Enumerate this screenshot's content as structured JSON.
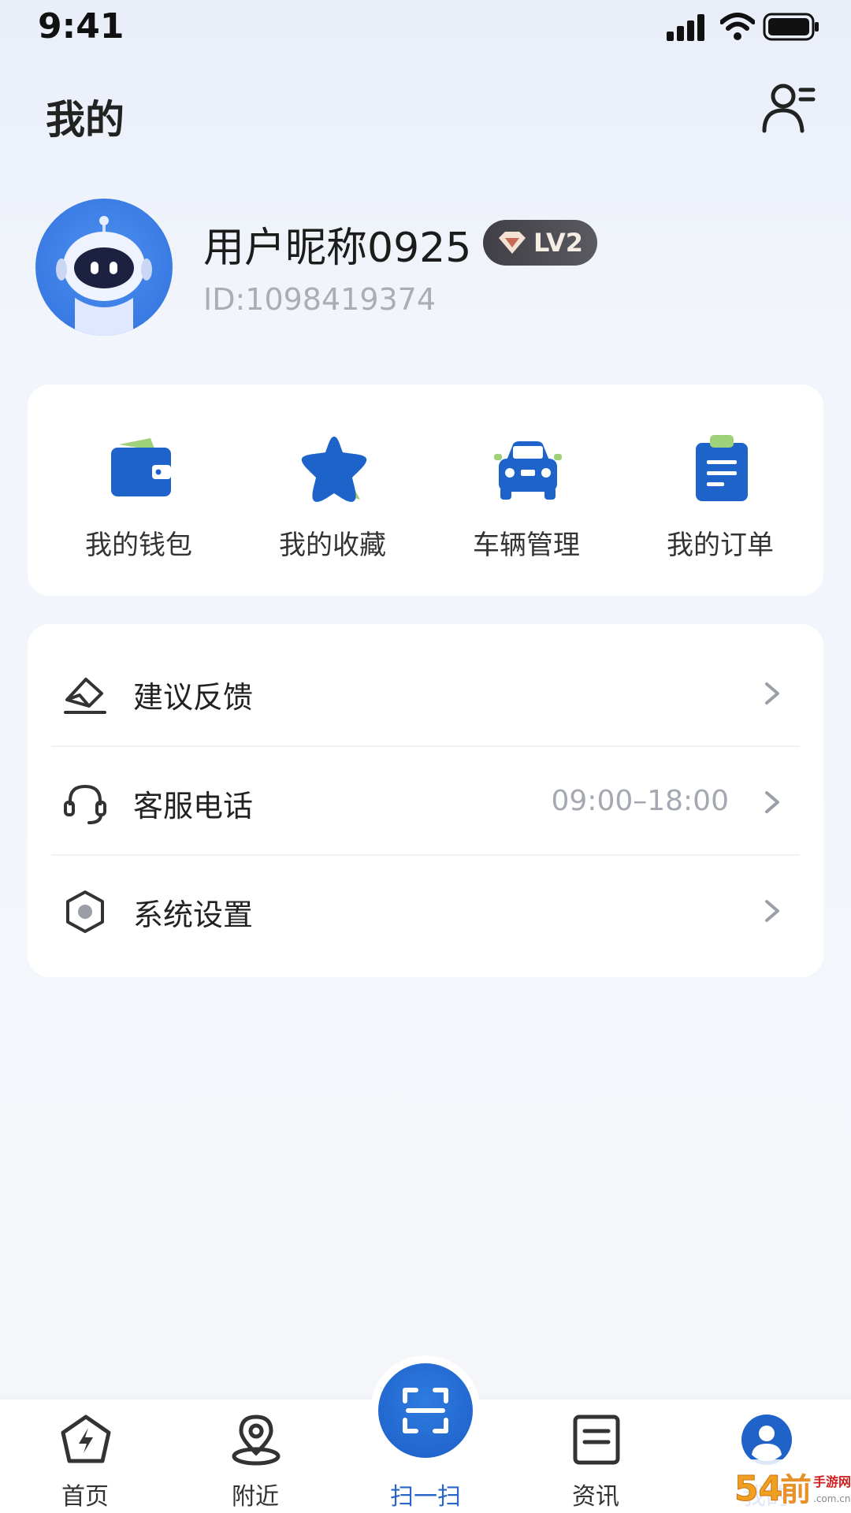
{
  "status_bar": {
    "time": "9:41"
  },
  "header": {
    "title": "我的"
  },
  "profile": {
    "nickname": "用户昵称0925",
    "level": "LV2",
    "user_id": "ID:1098419374"
  },
  "quick_actions": [
    {
      "label": "我的钱包",
      "icon": "wallet-icon"
    },
    {
      "label": "我的收藏",
      "icon": "star-icon"
    },
    {
      "label": "车辆管理",
      "icon": "car-icon"
    },
    {
      "label": "我的订单",
      "icon": "clipboard-icon"
    }
  ],
  "menu": [
    {
      "label": "建议反馈",
      "value": "",
      "icon": "feedback-icon"
    },
    {
      "label": "客服电话",
      "value": "09:00–18:00",
      "icon": "headset-icon"
    },
    {
      "label": "系统设置",
      "value": "",
      "icon": "settings-icon"
    }
  ],
  "tabs": [
    {
      "label": "首页",
      "icon": "home-icon"
    },
    {
      "label": "附近",
      "icon": "location-icon"
    },
    {
      "label": "扫一扫",
      "icon": "scan-icon"
    },
    {
      "label": "资讯",
      "icon": "news-icon"
    },
    {
      "label": "我的",
      "icon": "profile-icon"
    }
  ],
  "active_tab": "我的",
  "watermark": {
    "text": "54前手游网"
  },
  "colors": {
    "accent": "#1f63c8",
    "badge_bg": "#46464c",
    "muted": "#a9adb6"
  }
}
